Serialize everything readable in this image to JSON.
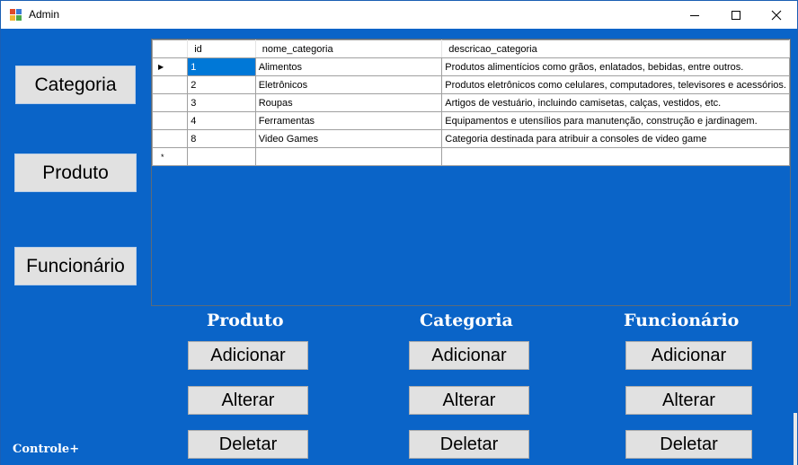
{
  "window": {
    "title": "Admin",
    "minimize_glyph": "—",
    "colors": {
      "background": "#0a64c8",
      "titlebar": "#ffffff",
      "button": "#e1e1e1",
      "selection": "#0078d7"
    }
  },
  "sidebar": {
    "items": [
      {
        "label": "Categoria"
      },
      {
        "label": "Produto"
      },
      {
        "label": "Funcionário"
      }
    ]
  },
  "grid": {
    "columns": [
      "id",
      "nome_categoria",
      "descricao_categoria"
    ],
    "rows": [
      {
        "id": "1",
        "nome_categoria": "Alimentos",
        "descricao_categoria": "Produtos alimentícios como grãos, enlatados, bebidas, entre outros.",
        "current": true
      },
      {
        "id": "2",
        "nome_categoria": "Eletrônicos",
        "descricao_categoria": "Produtos eletrônicos como celulares, computadores, televisores e acessórios."
      },
      {
        "id": "3",
        "nome_categoria": "Roupas",
        "descricao_categoria": "Artigos de vestuário, incluindo camisetas, calças, vestidos, etc."
      },
      {
        "id": "4",
        "nome_categoria": "Ferramentas",
        "descricao_categoria": "Equipamentos e utensílios para manutenção, construção e jardinagem."
      },
      {
        "id": "8",
        "nome_categoria": "Video Games",
        "descricao_categoria": "Categoria destinada para atribuir a consoles de video game"
      }
    ],
    "current_row_marker": "▶",
    "new_row_marker": "*"
  },
  "sections": [
    {
      "title": "Produto",
      "buttons": {
        "add": "Adicionar",
        "edit": "Alterar",
        "delete": "Deletar"
      }
    },
    {
      "title": "Categoria",
      "buttons": {
        "add": "Adicionar",
        "edit": "Alterar",
        "delete": "Deletar"
      }
    },
    {
      "title": "Funcionário",
      "buttons": {
        "add": "Adicionar",
        "edit": "Alterar",
        "delete": "Deletar"
      }
    }
  ],
  "footer": {
    "brand": "Controle+"
  }
}
